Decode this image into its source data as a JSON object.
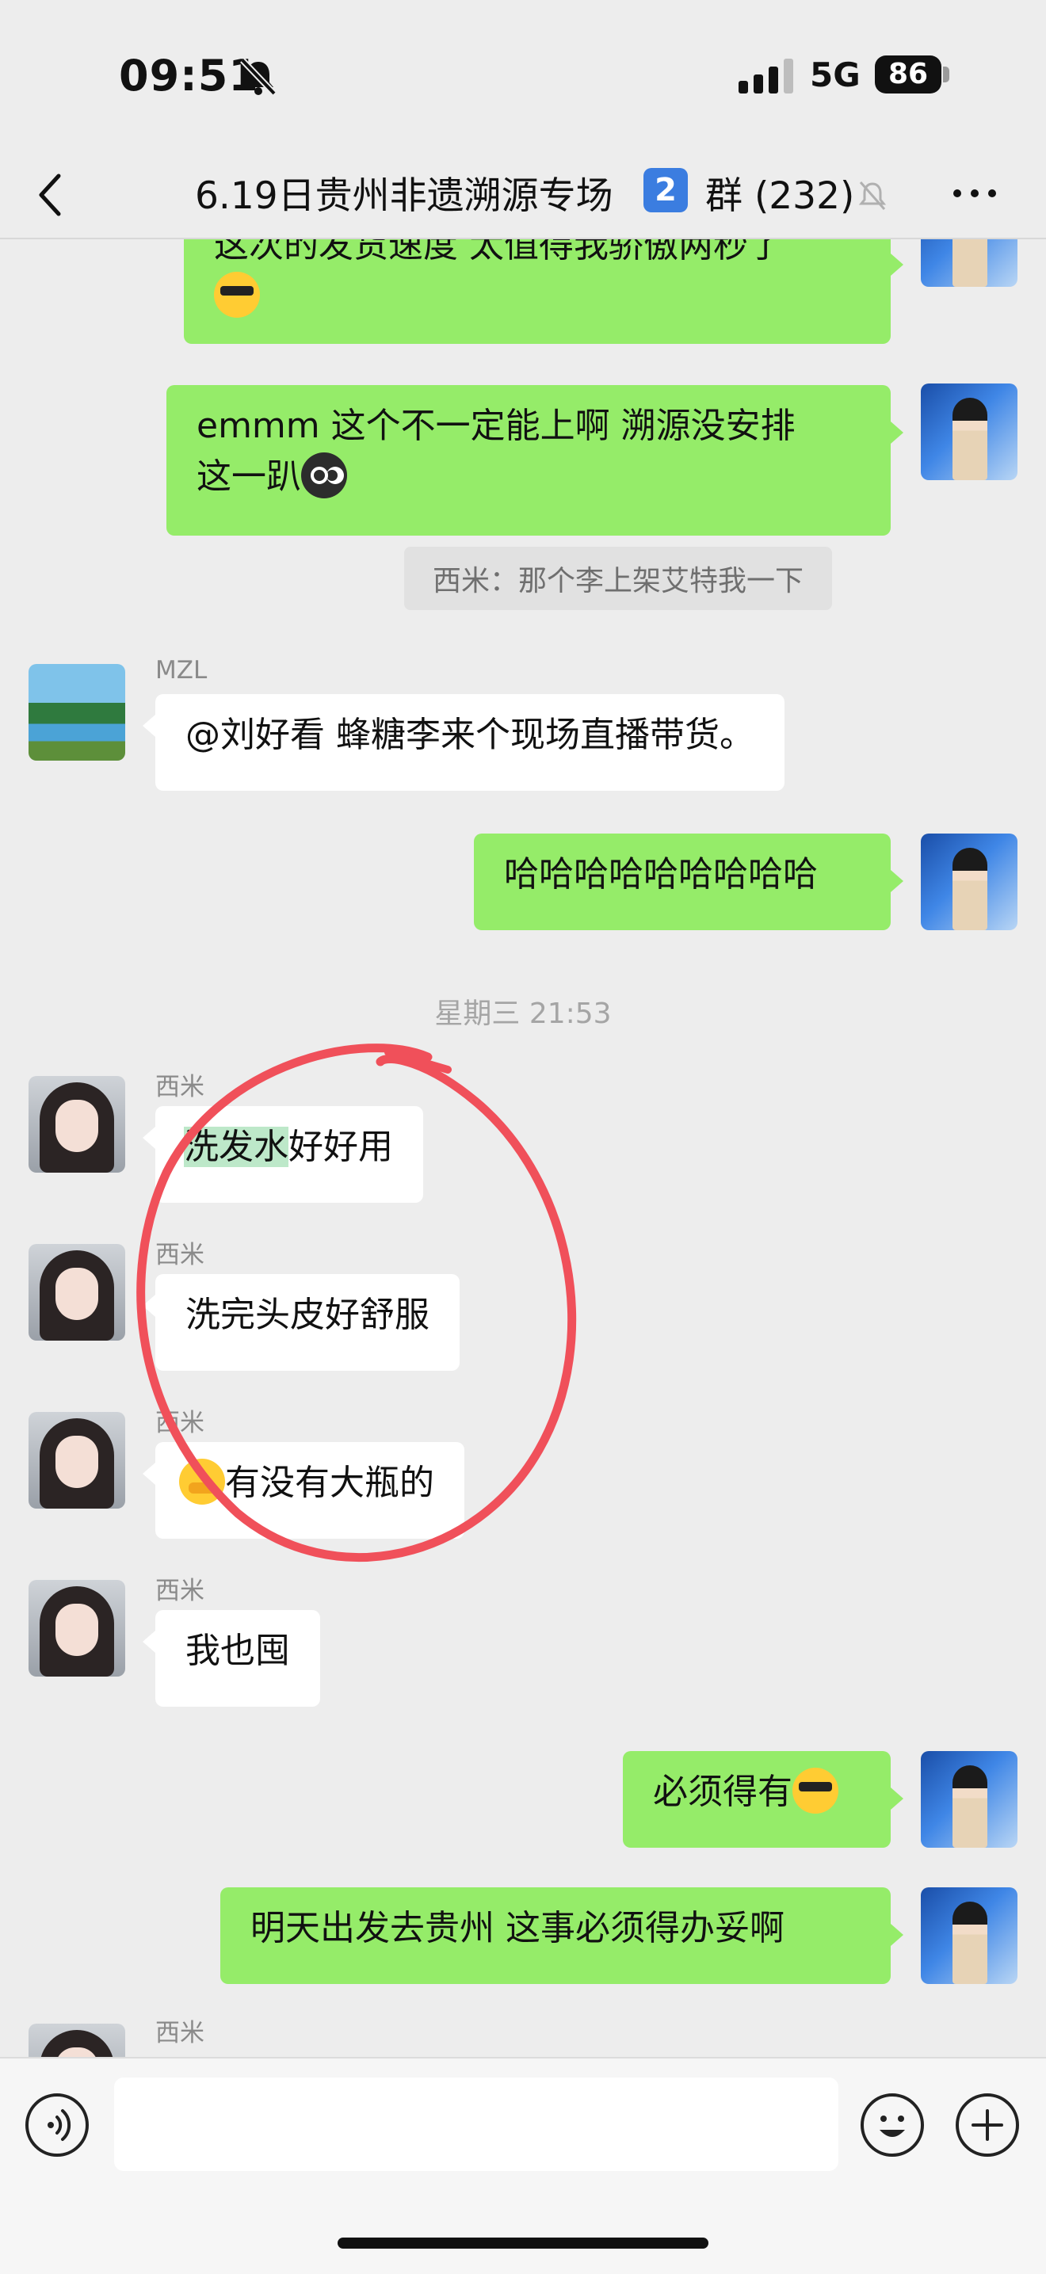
{
  "status": {
    "time": "09:51",
    "network": "5G",
    "battery": "86"
  },
  "header": {
    "title": "6.19日贵州非遗溯源专场",
    "badge": "2",
    "count": "群 (232)"
  },
  "messages": [
    {
      "side": "right",
      "text": "这次的发货速度 太值得我骄傲两秒了"
    },
    {
      "side": "right",
      "text_line1": "emmm 这个不一定能上啊 溯源没安排",
      "text_line2": "这一趴"
    },
    {
      "quote": "西米：那个李上架艾特我一下"
    },
    {
      "side": "left",
      "sender": "MZL",
      "text": "@刘好看 蜂糖李来个现场直播带货。"
    },
    {
      "side": "right",
      "text": "哈哈哈哈哈哈哈哈哈"
    },
    {
      "timestamp": "星期三 21:53"
    },
    {
      "side": "left",
      "sender": "西米",
      "highlight": "洗发水",
      "text": "好好用"
    },
    {
      "side": "left",
      "sender": "西米",
      "text": "洗完头皮好舒服"
    },
    {
      "side": "left",
      "sender": "西米",
      "text": "有没有大瓶的"
    },
    {
      "side": "left",
      "sender": "西米",
      "text": "我也囤"
    },
    {
      "side": "right",
      "text": "必须得有"
    },
    {
      "side": "right",
      "text": "明天出发去贵州 这事必须得办妥啊"
    },
    {
      "side": "left",
      "sender": "西米"
    }
  ],
  "input": {
    "placeholder": ""
  },
  "colors": {
    "own_bubble": "#95ec69",
    "other_bubble": "#ffffff",
    "annotation_circle": "#f0505a",
    "background": "#ededed"
  },
  "icons": [
    "bell-muted-icon",
    "signal-icon",
    "back-chevron-icon",
    "mute-icon",
    "more-icon",
    "voice-icon",
    "emoji-icon",
    "plus-icon"
  ]
}
